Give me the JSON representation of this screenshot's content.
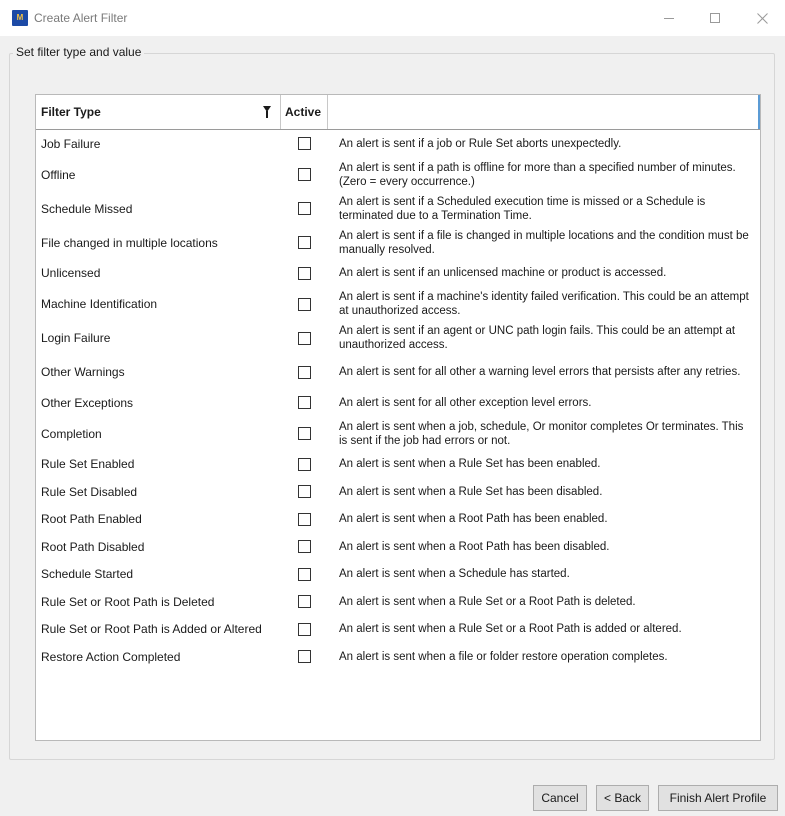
{
  "window": {
    "title": "Create Alert Filter",
    "app_icon_text": "M"
  },
  "group": {
    "label": "Set filter type and value"
  },
  "table": {
    "columns": [
      "Filter Type",
      "Active",
      ""
    ],
    "rows": [
      {
        "type": "Job Failure",
        "active": false,
        "desc": "An alert is sent if a job or Rule Set aborts unexpectedly."
      },
      {
        "type": "Offline",
        "active": false,
        "desc": "An alert is sent if a path is offline for more than a specified number of minutes. (Zero = every occurrence.)"
      },
      {
        "type": "Schedule Missed",
        "active": false,
        "desc": "An alert is sent if a Scheduled execution time is missed or a Schedule is terminated due to a Termination Time."
      },
      {
        "type": "File changed in multiple locations",
        "active": false,
        "desc": "An alert is sent if a file is changed in multiple locations and the condition must be manually resolved."
      },
      {
        "type": "Unlicensed",
        "active": false,
        "desc": "An alert is sent if an unlicensed machine or product is accessed."
      },
      {
        "type": "Machine Identification",
        "active": false,
        "desc": "An alert is sent if a machine's identity failed verification. This could be an attempt at unauthorized access."
      },
      {
        "type": "Login Failure",
        "active": false,
        "desc": "An alert is sent if an agent or UNC path login fails. This could be an attempt at unauthorized access."
      },
      {
        "type": "Other Warnings",
        "active": false,
        "desc": "An alert is sent for all other a warning level errors that persists after any retries."
      },
      {
        "type": "Other Exceptions",
        "active": false,
        "desc": "An alert is sent for all other exception level errors."
      },
      {
        "type": "Completion",
        "active": false,
        "desc": "An alert is sent when a job, schedule, Or monitor completes Or terminates. This is sent if the job had errors or not."
      },
      {
        "type": "Rule Set Enabled",
        "active": false,
        "desc": "An alert is sent when a Rule Set has been enabled."
      },
      {
        "type": "Rule Set Disabled",
        "active": false,
        "desc": "An alert is sent when a Rule Set has been disabled."
      },
      {
        "type": "Root Path Enabled",
        "active": false,
        "desc": "An alert is sent when a Root Path has been enabled."
      },
      {
        "type": "Root Path Disabled",
        "active": false,
        "desc": "An alert is sent when a Root Path has been disabled."
      },
      {
        "type": "Schedule Started",
        "active": false,
        "desc": "An alert is sent when a Schedule has started."
      },
      {
        "type": "Rule Set or Root Path is Deleted",
        "active": false,
        "desc": "An alert is sent when a Rule Set or a Root Path is deleted."
      },
      {
        "type": "Rule Set or Root Path is Added or Altered",
        "active": false,
        "desc": "An alert is sent when a Rule Set or a Root Path is added or altered."
      },
      {
        "type": "Restore Action Completed",
        "active": false,
        "desc": "An alert is sent when a file or folder restore operation completes."
      }
    ]
  },
  "buttons": {
    "cancel": "Cancel",
    "back": "< Back",
    "finish": "Finish Alert Profile"
  },
  "icons": {
    "app": "app-logo-icon",
    "filter": "filter-funnel-icon",
    "minimize": "minimize-icon",
    "maximize": "maximize-icon",
    "close": "close-icon"
  }
}
